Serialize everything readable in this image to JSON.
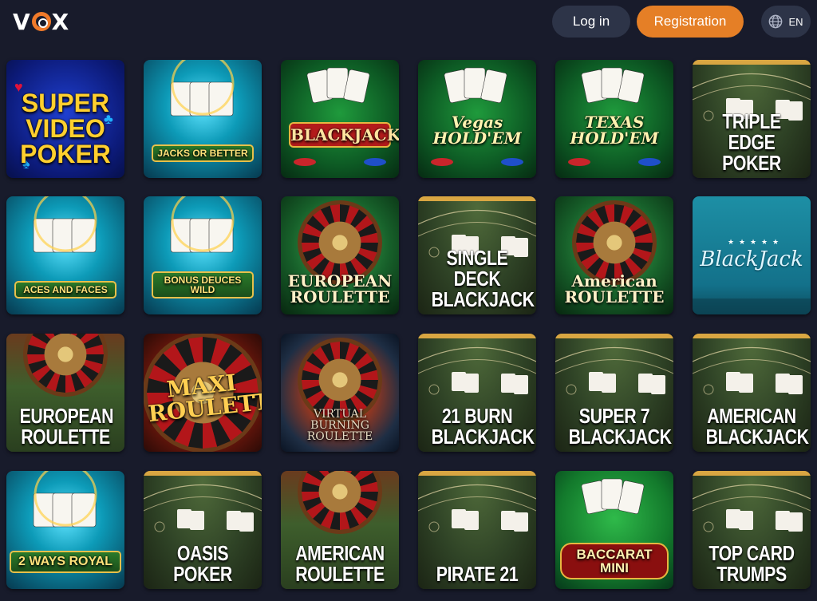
{
  "header": {
    "logo": "VOX",
    "login_label": "Log in",
    "register_label": "Registration",
    "language": "EN"
  },
  "games": [
    {
      "title": "SUPER\nVIDEO\nPOKER",
      "style": "logo3",
      "theme": "blue"
    },
    {
      "title": "JACKS OR BETTER",
      "style": "banner",
      "theme": "teal"
    },
    {
      "title": "BLACKJACK",
      "style": "bjgold",
      "theme": "green"
    },
    {
      "title": "Vegas\nHOLD'EM",
      "style": "holdem",
      "theme": "green"
    },
    {
      "title": "TEXAS\nHOLD'EM",
      "style": "holdem",
      "theme": "green"
    },
    {
      "title": "TRIPLE EDGE\nPOKER",
      "style": "big",
      "theme": "table"
    },
    {
      "title": "ACES AND FACES",
      "style": "banner",
      "theme": "teal"
    },
    {
      "title": "BONUS DEUCES WILD",
      "style": "banner",
      "theme": "teal"
    },
    {
      "title": "EUROPEAN\nROULETTE",
      "style": "serif",
      "theme": "roulette"
    },
    {
      "title": "SINGLE DECK\nBLACKJACK",
      "style": "big",
      "theme": "table"
    },
    {
      "title": "American\nROULETTE",
      "style": "serif",
      "theme": "roulette"
    },
    {
      "title": "BlackJack",
      "style": "script",
      "theme": "aqua"
    },
    {
      "title": "EUROPEAN\nROULETTE",
      "style": "big",
      "theme": "rtable"
    },
    {
      "title": "MAXI\nROULETTE",
      "style": "maxi",
      "theme": "red"
    },
    {
      "title": "VIRTUAL BURNING\nROULETTE",
      "style": "small",
      "theme": "fire"
    },
    {
      "title": "21 BURN\nBLACKJACK",
      "style": "big",
      "theme": "table"
    },
    {
      "title": "SUPER 7\nBLACKJACK",
      "style": "big",
      "theme": "table"
    },
    {
      "title": "AMERICAN\nBLACKJACK",
      "style": "big",
      "theme": "table"
    },
    {
      "title": "2 WAYS ROYAL",
      "style": "royal",
      "theme": "teal"
    },
    {
      "title": "OASIS POKER",
      "style": "big",
      "theme": "table"
    },
    {
      "title": "AMERICAN\nROULETTE",
      "style": "big",
      "theme": "rtable"
    },
    {
      "title": "PIRATE 21",
      "style": "big",
      "theme": "table"
    },
    {
      "title": "BACCARAT MINI",
      "style": "bacc",
      "theme": "bacc"
    },
    {
      "title": "TOP CARD\nTRUMPS",
      "style": "big",
      "theme": "table"
    }
  ],
  "colors": {
    "background": "#181b2b",
    "accent": "#e57f26",
    "button_dark": "#2d3448"
  },
  "icons": {
    "language": "globe-icon"
  }
}
